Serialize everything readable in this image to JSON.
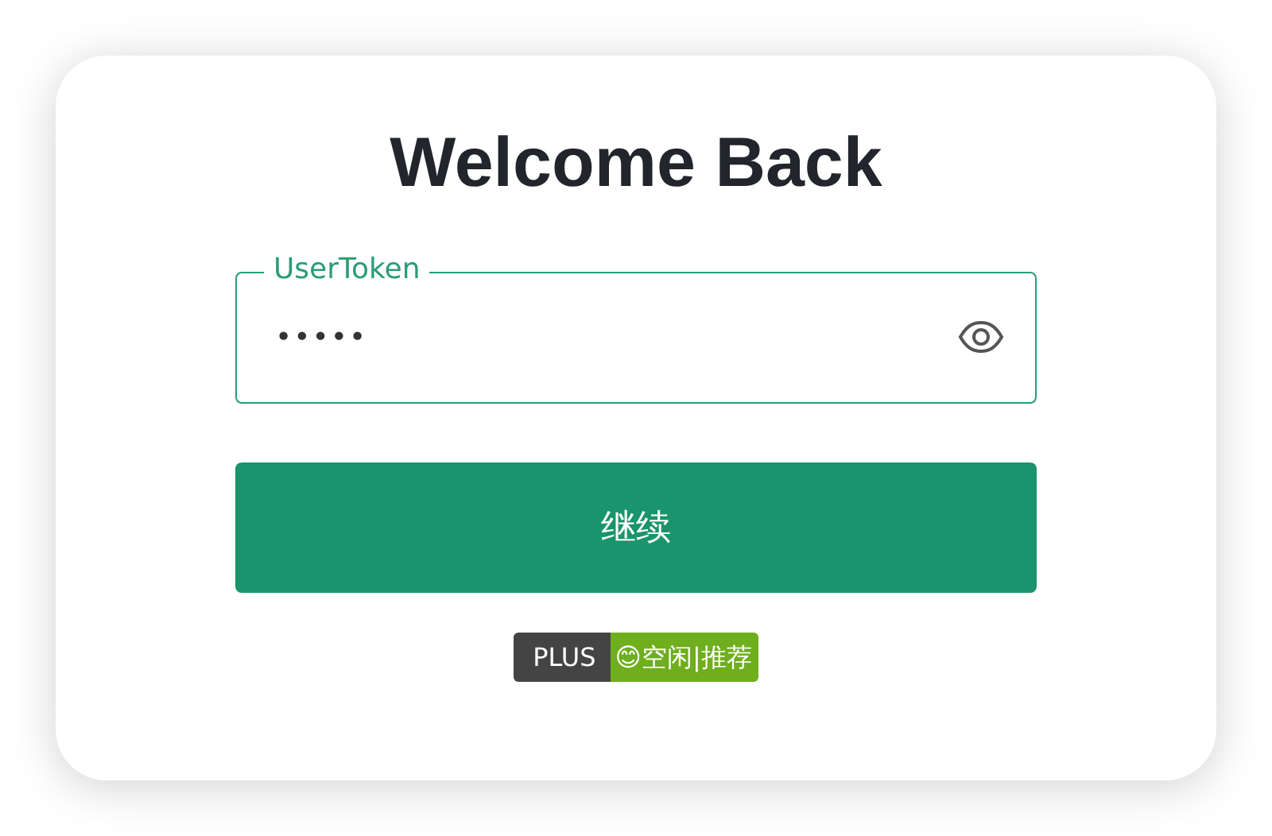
{
  "title": "Welcome Back",
  "token_field": {
    "label": "UserToken",
    "value": "•••••",
    "focused": true
  },
  "continue_button": "继续",
  "status_badge": {
    "label": "PLUS",
    "status": "😊空闲|推荐"
  }
}
